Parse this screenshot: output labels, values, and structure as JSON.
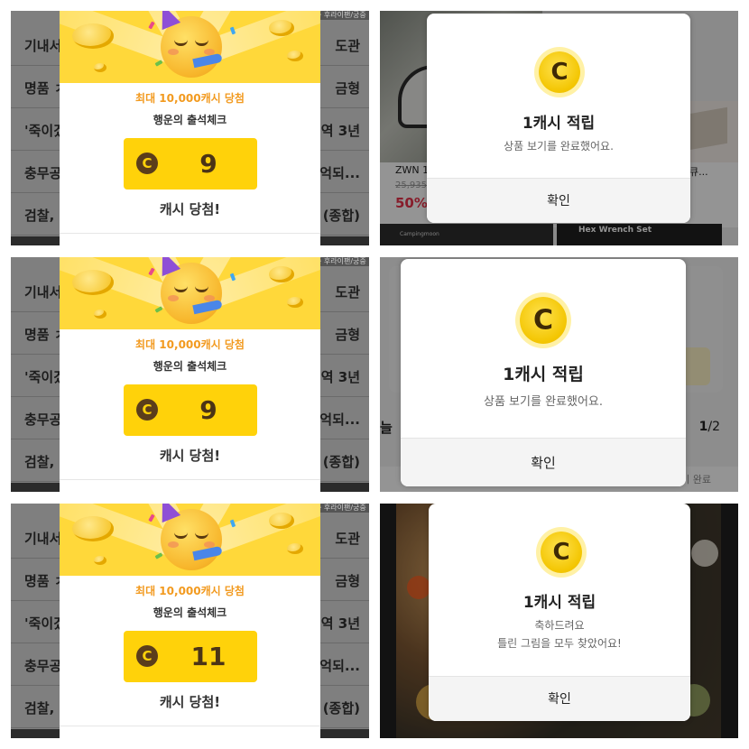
{
  "attendance_panels": [
    {
      "top_label": "중 후라이팬/궁중",
      "news": [
        {
          "left": "기내서",
          "right": "도관"
        },
        {
          "left": "명품 ㅈ",
          "right": "금형"
        },
        {
          "left": "'죽이겠",
          "right": "역 3년"
        },
        {
          "left": "충무공",
          "right": "억되..."
        },
        {
          "left": "검찰, '",
          "right": "(종합)"
        }
      ],
      "prize_title": "최대 10,000캐시 당첨",
      "subtitle": "행운의 출석체크",
      "coin_symbol": "C",
      "amount": "9",
      "result": "캐시 당첨!"
    },
    {
      "top_label": "중 후라이팬/궁중",
      "news": [
        {
          "left": "기내서",
          "right": "도관"
        },
        {
          "left": "명품 ㅈ",
          "right": "금형"
        },
        {
          "left": "'죽이겠",
          "right": "역 3년"
        },
        {
          "left": "충무공",
          "right": "억되..."
        },
        {
          "left": "검찰, '",
          "right": "(종합)"
        }
      ],
      "prize_title": "최대 10,000캐시 당첨",
      "subtitle": "행운의 출석체크",
      "coin_symbol": "C",
      "amount": "9",
      "result": "캐시 당첨!"
    },
    {
      "top_label": "중 후라이팬/궁중",
      "news": [
        {
          "left": "기내서",
          "right": "도관"
        },
        {
          "left": "명품 ㅈ",
          "right": "금형"
        },
        {
          "left": "'죽이겠",
          "right": "역 3년"
        },
        {
          "left": "충무공",
          "right": "억되..."
        },
        {
          "left": "검찰, '",
          "right": "(종합)"
        }
      ],
      "prize_title": "최대 10,000캐시 당첨",
      "subtitle": "행운의 출석체크",
      "coin_symbol": "C",
      "amount": "11",
      "result": "캐시 당첨!"
    }
  ],
  "cash_dialogs": [
    {
      "coin_symbol": "C",
      "title": "1캐시 적립",
      "message_line1": "상품 보기를 완료했어요.",
      "message_line2": "",
      "confirm_label": "확인",
      "background": {
        "product_name": "ZWN 1",
        "price": "25,935",
        "discount": "50%",
        "right_text": "큐...",
        "banner_brand": "Campingmoon",
        "banner_title": "Hex Wrench Set"
      }
    },
    {
      "coin_symbol": "C",
      "title": "1캐시 적립",
      "message_line1": "상품 보기를 완료했어요.",
      "message_line2": "",
      "confirm_label": "확인",
      "background": {
        "side_label": "늘",
        "page_current": "1",
        "page_total": "/2",
        "footer_text": "받기 완료"
      }
    },
    {
      "coin_symbol": "C",
      "title": "1캐시 적립",
      "message_line1": "축하드려요",
      "message_line2": "틀린 그림을 모두 찾았어요!",
      "confirm_label": "확인",
      "background": {}
    }
  ],
  "colors": {
    "accent_yellow": "#ffd20a",
    "prize_orange": "#f29a1f",
    "coin_brown": "#5b3d1b",
    "discount_red": "#e8334a"
  },
  "icons": {
    "attendance_mascot": "party-face-icon",
    "cash_coin": "coin-icon"
  }
}
